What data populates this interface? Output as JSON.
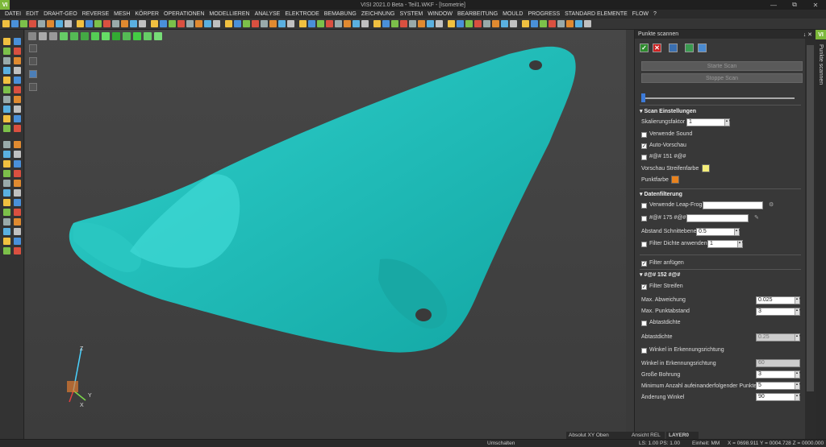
{
  "window": {
    "app_logo": "VI",
    "title": "VISI 2021.0 Beta - Teil1.WKF - [Isometrie]",
    "minimize": "—",
    "maximize": "⧉",
    "close": "✕"
  },
  "menu": [
    "DATEI",
    "EDIT",
    "DRAHT-GEO",
    "REVERSE",
    "MESH",
    "KÖRPER",
    "OPERATIONEN",
    "MODELLIEREN",
    "ANALYSE",
    "ELEKTRODE",
    "BEMABUNG",
    "ZEICHNUNG",
    "SYSTEM",
    "WINDOW",
    "BEARBEITUNG",
    "MOULD",
    "PROGRESS",
    "STANDARD ELEMENTE",
    "FLOW",
    "?"
  ],
  "viewport": {
    "mesh_color": "#1fbcb8",
    "axis_labels": {
      "z": "Z",
      "y": "Y",
      "x": "X"
    }
  },
  "panel": {
    "title": "Punkte scannen",
    "pin": "↓ ✕",
    "side_tab_logo": "VI",
    "side_tab_label": "Punkte scannen",
    "ok": "✓",
    "cancel": "✕",
    "start_scan": "Starte Scan",
    "stop_scan": "Stoppe Scan",
    "scan_settings": {
      "title": "Scan Einstellungen",
      "scale_label": "Skalierungsfaktor",
      "scale_value": "1",
      "use_sound": "Verwende Sound",
      "auto_preview": "Auto-Vorschau",
      "placeholder_151": "#@# 151 #@#",
      "stripe_color_label": "Vorschau Streifenfarbe",
      "stripe_color": "#f4ee7a",
      "point_color_label": "Punktfarbe",
      "point_color": "#e8821e"
    },
    "data_filter": {
      "title": "Datenfilterung",
      "leap_frog": "Verwende Leap-Frog",
      "placeholder_175": "#@# 175 #@#",
      "section_distance_label": "Abstand Schnittebene",
      "section_distance_value": "0.5",
      "density_filter_label": "Filter Dichte anwenden",
      "density_filter_value": "1",
      "add_filter": "Filter anfügen",
      "sub_section": "#@# 152 #@#",
      "filter_stripes": "Filter Streifen",
      "max_dev_label": "Max. Abweichung",
      "max_dev_value": "0.025",
      "max_point_dist_label": "Max. Punktabstand",
      "max_point_dist_value": "3",
      "scan_density_chk": "Abtastdichte",
      "scan_density_label": "Abtastdichte",
      "scan_density_value": "0.25",
      "angle_dir_chk": "Winkel in Erkennungsrichtung",
      "angle_dir_label": "Winkel in Erkennungsrichtung",
      "angle_dir_value": "60",
      "hole_size_label": "Große Bohrung",
      "hole_size_value": "3",
      "min_points_label": "Minimum Anzahl aufeinanderfolgender Punkte",
      "min_points_value": "5",
      "angle_change_label": "Änderung Winkel",
      "angle_change_value": "90"
    }
  },
  "status": {
    "view_mode": "Absolut XY Oben",
    "view_rel": "Ansicht REL",
    "layer": "LAYER0",
    "toggle": "Umschalten",
    "ls_ps": "LS: 1.00 PS: 1.00",
    "units": "Einheit: MM",
    "coords": "X = 0698.911 Y = 0004.728 Z = 0000.000"
  }
}
